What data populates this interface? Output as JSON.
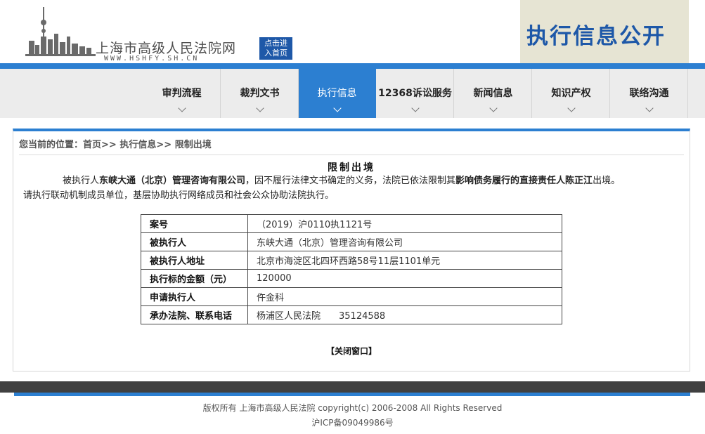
{
  "header": {
    "site_name": "上海市高级人民法院网",
    "site_url": "WWW.HSHFY.SH.CN",
    "home_button": "点击进\n入首页",
    "banner": "执行信息公开"
  },
  "nav": {
    "items": [
      {
        "label": "审判流程"
      },
      {
        "label": "裁判文书"
      },
      {
        "label": "执行信息"
      },
      {
        "label": "12368诉讼服务"
      },
      {
        "label": "新闻信息"
      },
      {
        "label": "知识产权"
      },
      {
        "label": "联络沟通"
      }
    ],
    "active_index": 2
  },
  "breadcrumb": {
    "prefix": "您当前的位置：",
    "home": "首页",
    "sep1": ">>",
    "level1": "执行信息",
    "sep2": ">>",
    "current": "限制出境"
  },
  "document": {
    "title": "限制出境",
    "p_intro": "被执行人",
    "p_debtor": "东峡大通（北京）管理咨询有限公司",
    "p_mid": "，因不履行法律文书确定的义务，法院已依法限制其",
    "p_person": "影响债务履行的直接责任人陈正江",
    "p_end": "出境。",
    "p_line2": "请执行联动机制成员单位，基层协助执行网络成员和社会公众协助法院执行。"
  },
  "table": {
    "rows": [
      {
        "key": "案号",
        "value": "（2019）沪0110执1121号"
      },
      {
        "key": "被执行人",
        "value": "东峡大通（北京）管理咨询有限公司"
      },
      {
        "key": "被执行人地址",
        "value": "北京市海淀区北四环西路58号11层1101单元"
      },
      {
        "key": "执行标的金额（元）",
        "value": "120000"
      },
      {
        "key": "申请执行人",
        "value": "仵金科"
      },
      {
        "key": "承办法院、联系电话",
        "value": "杨浦区人民法院",
        "phone": "35124588"
      }
    ]
  },
  "close_link": "【关闭窗口】",
  "footer": {
    "copyright": "版权所有 上海市高级人民法院 copyright(c) 2006-2008 All Rights Reserved",
    "icp": "沪ICP备09049986号"
  },
  "colors": {
    "primary_blue": "#2c7fd1",
    "banner_bg": "#e6e4d3",
    "banner_text": "#1e58a8",
    "nav_bg": "#ececec",
    "footer_dark": "#404040"
  }
}
